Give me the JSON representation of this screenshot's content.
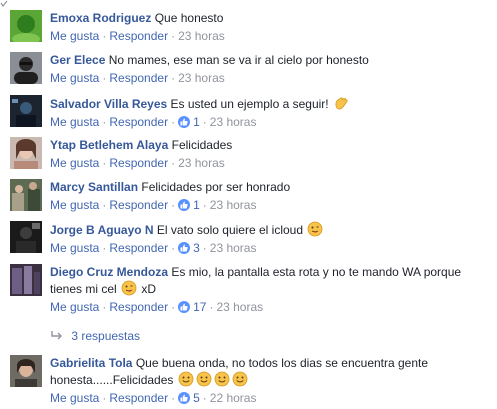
{
  "icons": {
    "corner": "corner-check-icon",
    "like": "thumbs-up-icon",
    "wave": "waving-hand-emoji",
    "tongue": "tongue-out-emoji",
    "smile": "smiley-emoji",
    "reply": "reply-arrow-icon"
  },
  "colors": {
    "author": "#365899",
    "link": "#4267b2",
    "meta": "#90949c",
    "like_badge": "#5890ff",
    "text": "#1d2129"
  },
  "comments": [
    {
      "author": "Emoxa Rodriguez",
      "text": "Que honesto",
      "like_label": "Me gusta",
      "reply_label": "Responder",
      "likes": "",
      "time": "23 horas"
    },
    {
      "author": "Ger Elece",
      "text": "No mames, ese man se va ir al cielo por honesto",
      "like_label": "Me gusta",
      "reply_label": "Responder",
      "likes": "",
      "time": "23 horas"
    },
    {
      "author": "Salvador Villa Reyes",
      "text": "Es usted un ejemplo a seguir!",
      "like_label": "Me gusta",
      "reply_label": "Responder",
      "likes": "1",
      "time": "23 horas"
    },
    {
      "author": "Ytap Betlehem Alaya",
      "text": "Felicidades",
      "like_label": "Me gusta",
      "reply_label": "Responder",
      "likes": "",
      "time": "23 horas"
    },
    {
      "author": "Marcy Santillan",
      "text": "Felicidades por ser honrado",
      "like_label": "Me gusta",
      "reply_label": "Responder",
      "likes": "1",
      "time": "23 horas"
    },
    {
      "author": "Jorge B Aguayo N",
      "text": "El vato solo quiere el icloud",
      "like_label": "Me gusta",
      "reply_label": "Responder",
      "likes": "3",
      "time": "23 horas"
    },
    {
      "author": "Diego Cruz Mendoza",
      "text": "Es mio, la pantalla esta rota y no te mando WA porque tienes mi cel",
      "text_suffix": "xD",
      "like_label": "Me gusta",
      "reply_label": "Responder",
      "likes": "17",
      "time": "23 horas"
    },
    {
      "author": "Gabrielita Tola",
      "text": "Que buena onda, no todos los dias se encuentra gente honesta......Felicidades",
      "like_label": "Me gusta",
      "reply_label": "Responder",
      "likes": "5",
      "time": "22 horas"
    }
  ],
  "replies_link": "3 respuestas",
  "separator": "·"
}
